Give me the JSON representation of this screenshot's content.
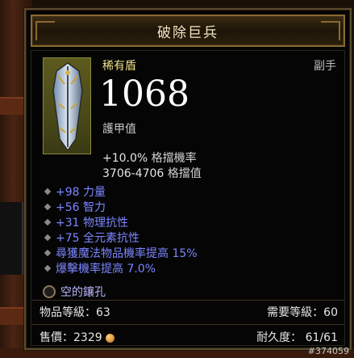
{
  "tooltip": {
    "title": "破除巨兵",
    "rarity": "稀有盾",
    "slot_type": "副手",
    "armor_value": "1068",
    "armor_label": "護甲值",
    "block_chance": {
      "value": "+10.0%",
      "label": "格擋機率"
    },
    "block_amount": {
      "value": "3706-4706",
      "label": "格擋值"
    },
    "affixes": [
      "+98 力量",
      "+56 智力",
      "+31 物理抗性",
      "+75 全元素抗性",
      "尋獲魔法物品機率提高 15%",
      "爆擊機率提高 7.0%"
    ],
    "socket_label": "空的鑲孔",
    "item_level": "物品等級：63",
    "required_level": "需要等級：60",
    "sell_price_label": "售價：",
    "sell_price_value": "2329",
    "durability_label": "耐久度：",
    "durability_value": "61/61"
  },
  "overlay": {
    "image_id": "#374059"
  },
  "colors": {
    "title": "#f2e6c0",
    "rarity": "#f0e38a",
    "affix": "#7b86ff",
    "frame_border": "#8a6a30"
  },
  "icons": {
    "item": "shield-icon",
    "socket": "socket-icon",
    "gold": "gold-coin-icon"
  }
}
